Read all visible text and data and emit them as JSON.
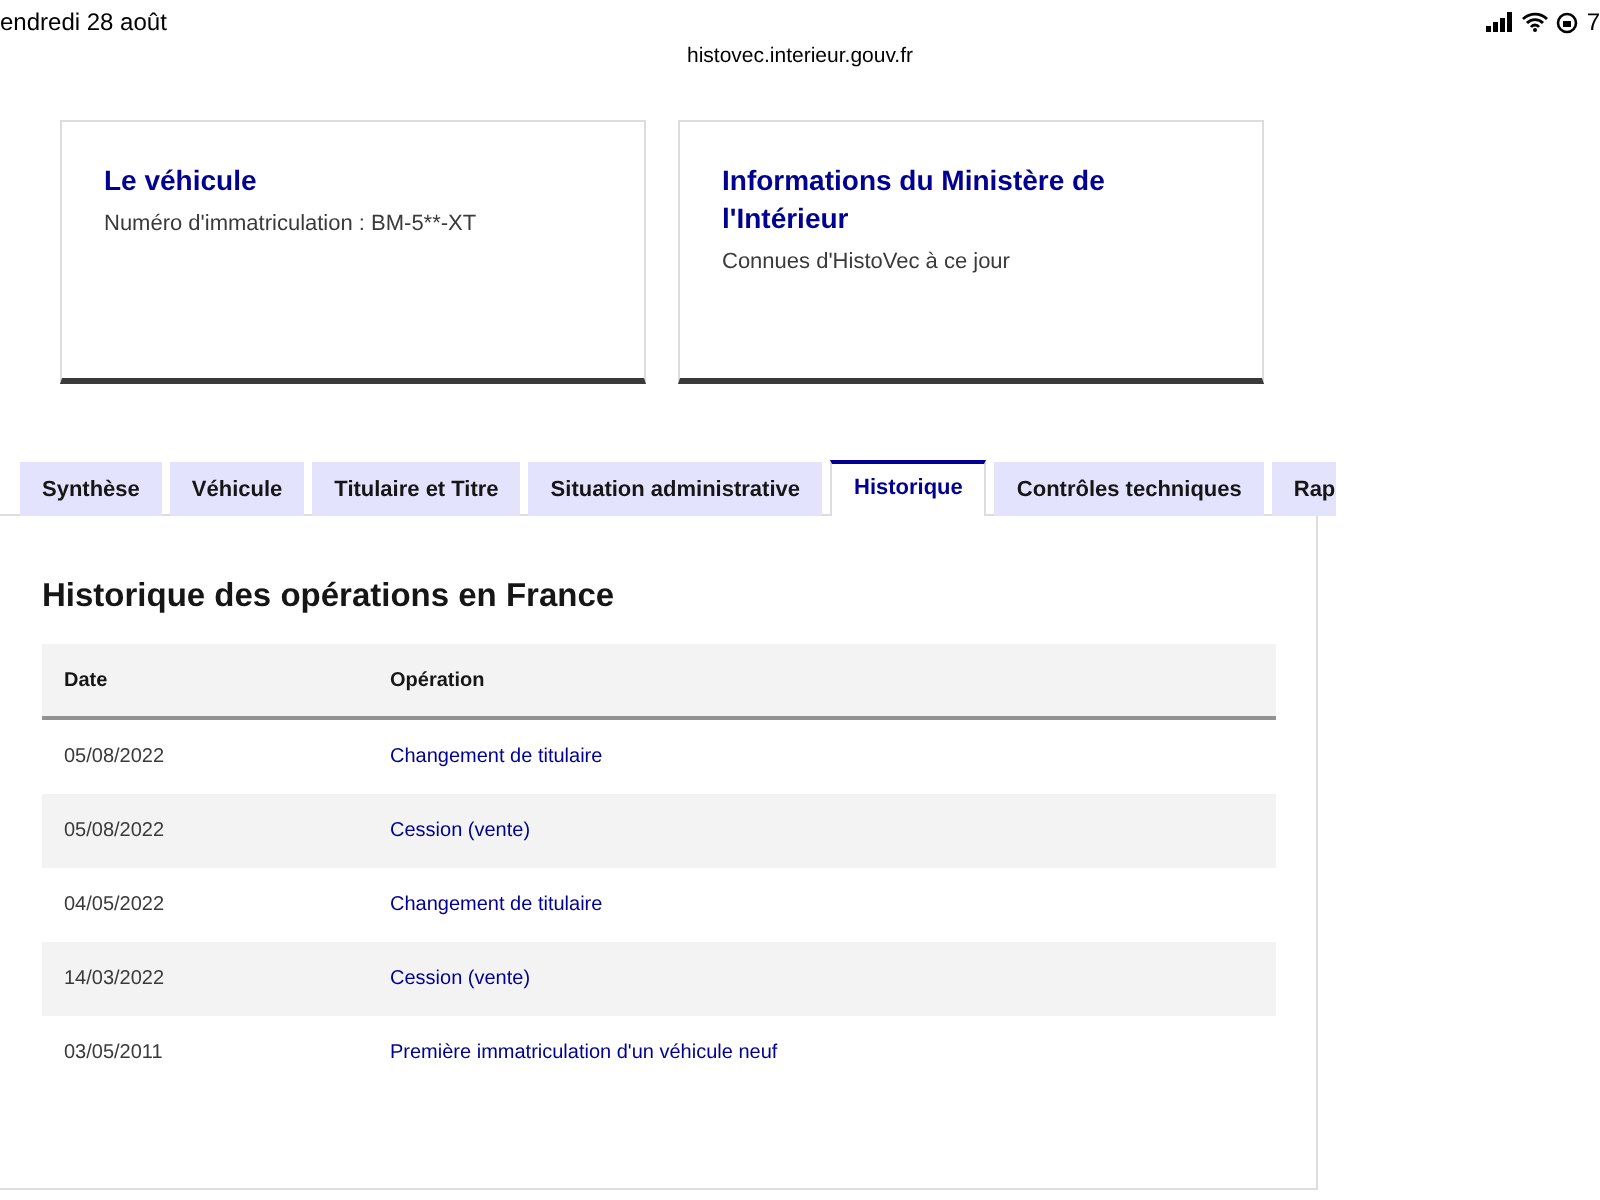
{
  "status_bar": {
    "date": "endredi 28 août",
    "battery": "7"
  },
  "address_bar": {
    "url": "histovec.interieur.gouv.fr"
  },
  "cards": [
    {
      "title": "Le véhicule",
      "text": "Numéro d'immatriculation : BM-5**-XT"
    },
    {
      "title": "Informations du Ministère de l'Intérieur",
      "text": "Connues d'HistoVec à ce jour"
    }
  ],
  "tabs": [
    {
      "label": "Synthèse",
      "selected": false
    },
    {
      "label": "Véhicule",
      "selected": false
    },
    {
      "label": "Titulaire et Titre",
      "selected": false
    },
    {
      "label": "Situation administrative",
      "selected": false
    },
    {
      "label": "Historique",
      "selected": true
    },
    {
      "label": "Contrôles techniques",
      "selected": false
    },
    {
      "label": "Rap",
      "selected": false
    }
  ],
  "panel": {
    "title": "Historique des opérations en France",
    "table": {
      "columns": [
        "Date",
        "Opération"
      ],
      "rows": [
        [
          "05/08/2022",
          "Changement de titulaire"
        ],
        [
          "05/08/2022",
          "Cession (vente)"
        ],
        [
          "04/05/2022",
          "Changement de titulaire"
        ],
        [
          "14/03/2022",
          "Cession (vente)"
        ],
        [
          "03/05/2011",
          "Première immatriculation d'un véhicule neuf"
        ]
      ]
    }
  }
}
